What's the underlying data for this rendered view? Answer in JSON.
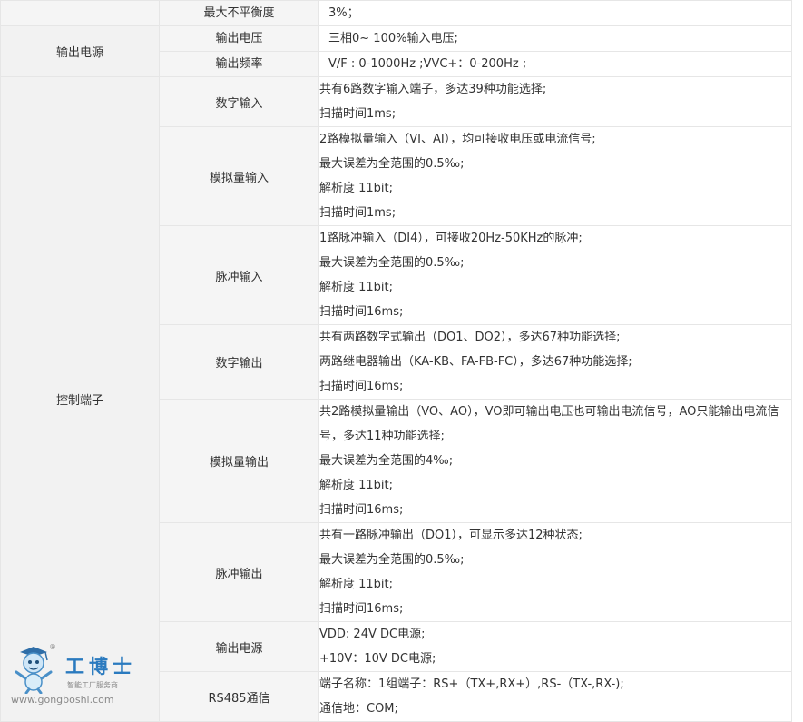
{
  "rows": {
    "imbalance": {
      "param": "最大不平衡度",
      "value": "3%；"
    },
    "output_power": {
      "category": "输出电源",
      "voltage": {
        "param": "输出电压",
        "value": "三相0~ 100%输入电压;"
      },
      "frequency": {
        "param": "输出频率",
        "value": "V/F : 0-1000Hz ;VVC+：0-200Hz ;"
      }
    },
    "control_terminal": {
      "category": "控制端子",
      "digital_input": {
        "param": "数字输入",
        "lines": [
          "共有6路数字输入端子，多达39种功能选择;",
          "扫描时间1ms;"
        ]
      },
      "analog_input": {
        "param": "模拟量输入",
        "lines": [
          "2路模拟量输入（VI、AI），均可接收电压或电流信号;",
          "最大误差为全范围的0.5‰;",
          "解析度 11bit;",
          "扫描时间1ms;"
        ]
      },
      "pulse_input": {
        "param": "脉冲输入",
        "lines": [
          "1路脉冲输入（DI4），可接收20Hz-50KHz的脉冲;",
          "最大误差为全范围的0.5‰;",
          "解析度 11bit;",
          "扫描时间16ms;"
        ]
      },
      "digital_output": {
        "param": "数字输出",
        "lines": [
          "共有两路数字式输出（DO1、DO2），多达67种功能选择;",
          "两路继电器输出（KA-KB、FA-FB-FC），多达67种功能选择;",
          "扫描时间16ms;"
        ]
      },
      "analog_output": {
        "param": "模拟量输出",
        "lines": [
          "共2路模拟量输出（VO、AO），VO即可输出电压也可输出电流信号，AO只能输出电流信号，多达11种功能选择;",
          "最大误差为全范围的4‰;",
          "解析度 11bit;",
          "扫描时间16ms;"
        ]
      },
      "pulse_output": {
        "param": "脉冲输出",
        "lines": [
          "共有一路脉冲输出（DO1），可显示多达12种状态;",
          "最大误差为全范围的0.5‰;",
          "解析度 11bit;",
          "扫描时间16ms;"
        ]
      },
      "power_output": {
        "param": "输出电源",
        "lines": [
          "VDD: 24V DC电源;",
          "+10V：10V DC电源;"
        ]
      },
      "rs485": {
        "param": "RS485通信",
        "lines": [
          "端子名称：1组端子：RS+（TX+,RX+）,RS-（TX-,RX-);",
          "通信地：COM;"
        ]
      }
    }
  },
  "logo": {
    "brand": "工博士",
    "registered": "®",
    "tagline": "智能工厂服务商",
    "url": "www.gongboshi.com",
    "mascot_icon": "robot-mascot-icon",
    "brand_color": "#2a7abf"
  }
}
